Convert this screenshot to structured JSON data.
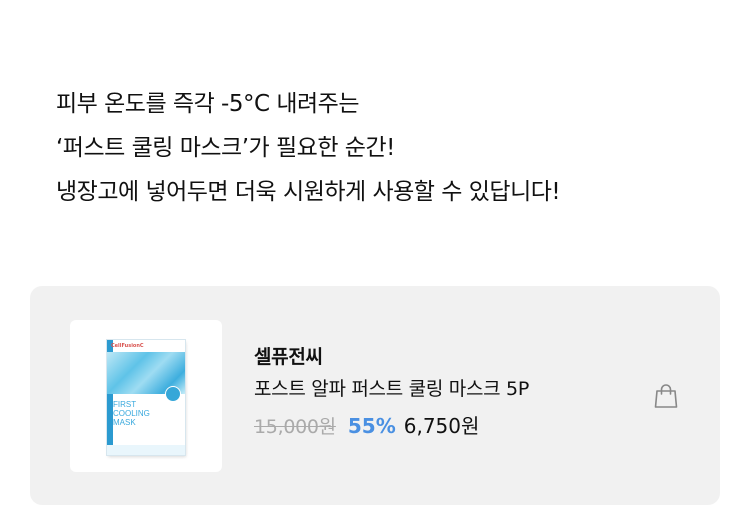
{
  "intro": {
    "lines": [
      "피부 온도를 즉각 -5°C 내려주는",
      "‘퍼스트 쿨링 마스크’가 필요한 순간!",
      "냉장고에 넣어두면 더욱 시원하게 사용할 수 있답니다!"
    ]
  },
  "product": {
    "brand": "셀퓨전씨",
    "name": "포스트 알파 퍼스트 쿨링 마스크 5P",
    "original_price": "15,000원",
    "discount": "55%",
    "sale_price": "6,750원",
    "thumbnail": {
      "brand_text": "CellFusionC",
      "title_lines": [
        "FIRST",
        "COOLING",
        "MASK"
      ]
    }
  },
  "icons": {
    "bag": "shopping-bag-icon"
  },
  "colors": {
    "discount": "#4a90e2",
    "card_bg": "#f1f1f1",
    "strike_price": "#aaaaaa"
  }
}
